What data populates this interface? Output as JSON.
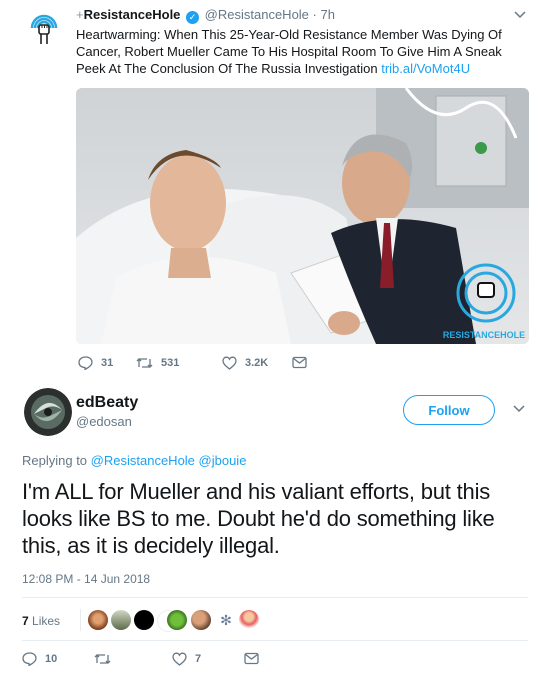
{
  "quoted_tweet": {
    "plus": "+",
    "name": "ResistanceHole",
    "handle": "@ResistanceHole",
    "separator": "·",
    "time": "7h",
    "text": "Heartwarming: When This 25-Year-Old Resistance Member Was Dying Of Cancer, Robert Mueller Came To His Hospital Room To Give Him A Sneak Peek At The Conclusion Of The Russia Investigation",
    "link": "trib.al/VoMot4U",
    "image_watermark": "RESISTANCEHOLE",
    "replies": "31",
    "retweets": "531",
    "likes": "3.2K"
  },
  "reply_tweet": {
    "name": "edBeaty",
    "handle": "@edosan",
    "follow_label": "Follow",
    "replying_to_prefix": "Replying to",
    "replying_to_handles": "@ResistanceHole @jbouie",
    "text": "I'm ALL for Mueller and his valiant efforts, but this looks like BS to me. Doubt he'd do something like this, as it is decidely illegal.",
    "timestamp": "12:08 PM - 14 Jun 2018",
    "likes_count": "7",
    "likes_word": "Likes",
    "reply_count": "10",
    "like_action_count": "7"
  },
  "colors": {
    "accent": "#1da1f2",
    "muted": "#657786",
    "text": "#14171a"
  }
}
